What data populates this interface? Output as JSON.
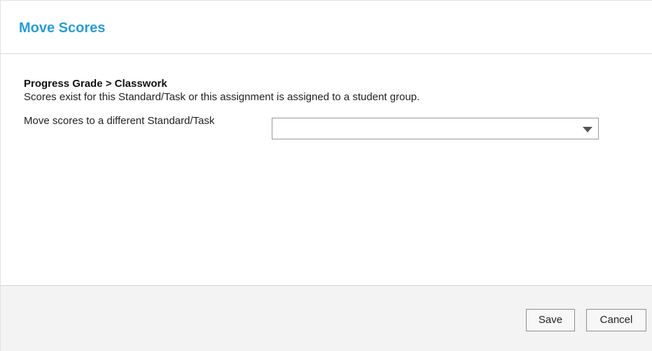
{
  "dialog": {
    "title": "Move Scores"
  },
  "body": {
    "breadcrumb": "Progress Grade > Classwork",
    "info": "Scores exist for this Standard/Task or this assignment is assigned to a student group.",
    "move_label": "Move scores to a different Standard/Task",
    "select": {
      "selected_value": "",
      "icon": "chevron-down-icon"
    }
  },
  "footer": {
    "save_label": "Save",
    "cancel_label": "Cancel"
  },
  "colors": {
    "title": "#2a9bd3",
    "footer_bg": "#f3f3f3"
  }
}
